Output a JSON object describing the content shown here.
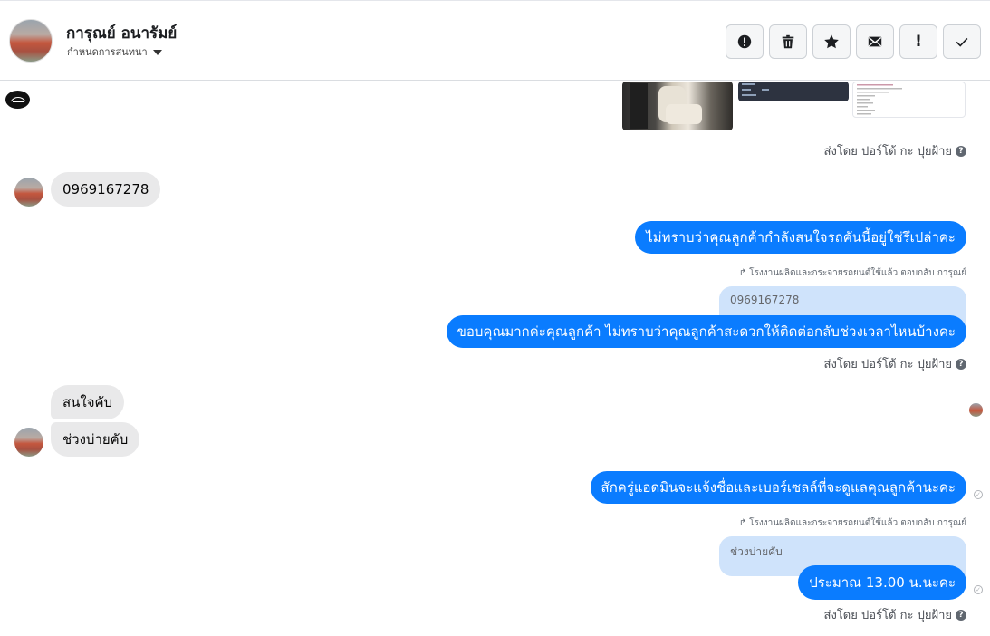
{
  "header": {
    "contact_name": "การุณย์ อนารัมย์",
    "assign_label": "กำหนดการสนทนา",
    "actions": [
      {
        "name": "report-button",
        "icon": "alert-circle-icon"
      },
      {
        "name": "delete-button",
        "icon": "trash-icon"
      },
      {
        "name": "star-button",
        "icon": "star-icon"
      },
      {
        "name": "mark-unread-button",
        "icon": "envelope-icon"
      },
      {
        "name": "follow-up-button",
        "icon": "exclamation-icon",
        "glyph": "!"
      },
      {
        "name": "mark-done-button",
        "icon": "checkmark-icon"
      }
    ]
  },
  "conversation": {
    "sent_by_1": "ส่งโดย ปอร์โต้ กะ ปุยฝ้าย",
    "incoming_phone": "0969167278",
    "out_msg_1": "ไม่ทราบว่าคุณลูกค้ากำลังสนใจรถคันนี้อยู่ใช่รึเปล่าคะ",
    "reply_meta_1": "โรงงานผลิตและกระจายรถยนต์ใช้แล้ว ตอบกลับ การุณย์",
    "quote_1": "0969167278",
    "out_msg_2": "ขอบคุณมากค่ะคุณลูกค้า ไม่ทราบว่าคุณลูกค้าสะดวกให้ติดต่อกลับช่วงเวลาไหนบ้างคะ",
    "sent_by_2": "ส่งโดย ปอร์โต้ กะ ปุยฝ้าย",
    "incoming_2": "สนใจคับ",
    "incoming_3": "ช่วงบ่ายคับ",
    "out_msg_3": "สักครู่แอดมินจะแจ้งชื่อและเบอร์เซลล์ที่จะดูแลคุณลูกค้านะคะ",
    "reply_meta_2": "โรงงานผลิตและกระจายรถยนต์ใช้แล้ว ตอบกลับ การุณย์",
    "quote_2": "ช่วงบ่ายคับ",
    "out_msg_4": "ประมาณ 13.00 น.นะคะ",
    "sent_by_3": "ส่งโดย ปอร์โต้ กะ ปุยฝ้าย"
  },
  "colors": {
    "outgoing_bubble": "#0a7cff",
    "incoming_bubble": "#e9e9ea",
    "quote_bubble": "#cfe3fb"
  }
}
